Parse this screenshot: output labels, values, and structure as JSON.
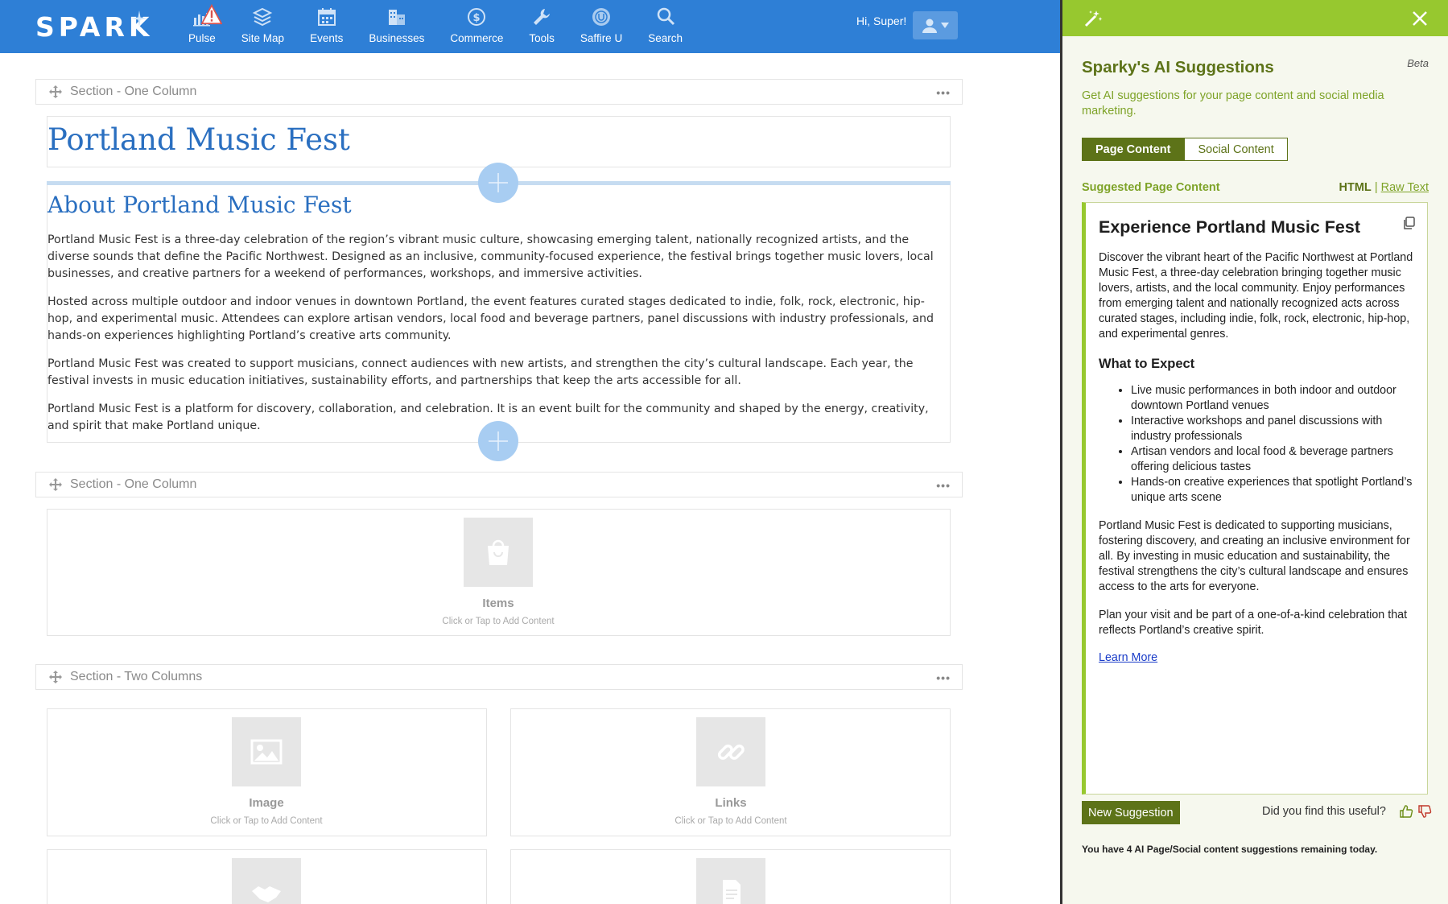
{
  "app": {
    "logo": "SPARK",
    "greeting": "Hi, Super!"
  },
  "nav": [
    {
      "label": "Pulse",
      "icon": "pulse-chart-icon"
    },
    {
      "label": "Site Map",
      "icon": "layers-icon"
    },
    {
      "label": "Events",
      "icon": "calendar-icon"
    },
    {
      "label": "Businesses",
      "icon": "buildings-icon"
    },
    {
      "label": "Commerce",
      "icon": "dollar-icon"
    },
    {
      "label": "Tools",
      "icon": "wrench-icon"
    },
    {
      "label": "Saffire U",
      "icon": "saffire-u-icon"
    },
    {
      "label": "Search",
      "icon": "search-icon"
    }
  ],
  "sections": [
    {
      "title": "Section - One Column"
    },
    {
      "title": "Section - One Column"
    },
    {
      "title": "Section - Two Columns"
    }
  ],
  "page": {
    "title": "Portland Music Fest",
    "about_heading": "About Portland Music Fest",
    "paragraphs": [
      "Portland Music Fest is a three-day celebration of the region’s vibrant music culture, showcasing emerging talent, nationally recognized artists, and the diverse sounds that define the Pacific Northwest. Designed as an inclusive, community-focused experience, the festival brings together music lovers, local businesses, and creative partners for a weekend of performances, workshops, and immersive activities.",
      "Hosted across multiple outdoor and indoor venues in downtown Portland, the event features curated stages dedicated to indie, folk, rock, electronic, hip-hop, and experimental music. Attendees can explore artisan vendors, local food and beverage partners, panel discussions with industry professionals, and hands-on experiences highlighting Portland’s creative arts community.",
      "Portland Music Fest was created to support musicians, connect audiences with new artists, and strengthen the city’s cultural landscape. Each year, the festival invests in music education initiatives, sustainability efforts, and partnerships that keep the arts accessible for all.",
      "Portland Music Fest is a platform for discovery, collaboration, and celebration. It is an event built for the community and shaped by the energy, creativity, and spirit that make Portland unique."
    ]
  },
  "placeholders": {
    "hint": "Click or Tap to Add Content",
    "items": "Items",
    "image": "Image",
    "links": "Links"
  },
  "ai_panel": {
    "title": "Sparky's AI Suggestions",
    "beta": "Beta",
    "description": "Get AI suggestions for your page content and social media marketing.",
    "tabs": [
      "Page Content",
      "Social Content"
    ],
    "suggested_label": "Suggested Page Content",
    "format_html": "HTML",
    "format_separator": "|",
    "format_raw": "Raw Text",
    "suggestion": {
      "heading": "Experience Portland Music Fest",
      "intro": "Discover the vibrant heart of the Pacific Northwest at Portland Music Fest, a three-day celebration bringing together music lovers, artists, and the local community. Enjoy performances from emerging talent and nationally recognized acts across curated stages, including indie, folk, rock, electronic, hip-hop, and experimental genres.",
      "subheading": "What to Expect",
      "bullets": [
        "Live music performances in both indoor and outdoor downtown Portland venues",
        "Interactive workshops and panel discussions with industry professionals",
        "Artisan vendors and local food & beverage partners offering delicious tastes",
        "Hands-on creative experiences that spotlight Portland’s unique arts scene"
      ],
      "p2": "Portland Music Fest is dedicated to supporting musicians, fostering discovery, and creating an inclusive environment for all. By investing in music education and sustainability, the festival strengthens the city’s cultural landscape and ensures access to the arts for everyone.",
      "p3": "Plan your visit and be part of a one-of-a-kind celebration that reflects Portland’s creative spirit.",
      "link": "Learn More"
    },
    "new_suggestion": "New Suggestion",
    "feedback_question": "Did you find this useful?",
    "remaining": "You have 4 AI Page/Social content suggestions remaining today."
  },
  "colors": {
    "nav_blue": "#2e7fd6",
    "panel_green": "#97c82f",
    "panel_dark_green": "#5d7318",
    "heading_blue": "#2a6fc0"
  }
}
